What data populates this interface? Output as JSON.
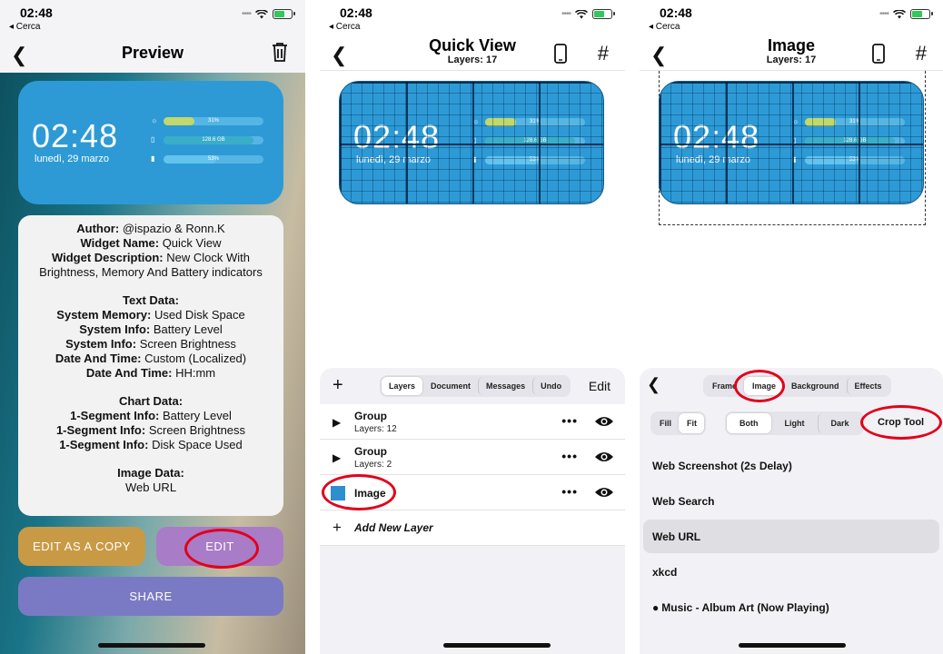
{
  "status": {
    "time": "02:48",
    "back": "◂ Cerca"
  },
  "widget": {
    "time": "02:48",
    "date": "lunedì, 29 marzo",
    "brightness": "31%",
    "memory": "128.6 GB",
    "battery": "53%",
    "brightness_fraction": 0.31,
    "memory_fraction": 0.9,
    "battery_fraction": 0.53,
    "colors": {
      "background": "#2d9ad6",
      "brightness_fill": "#c2d86a",
      "memory_fill": "#3aaec9",
      "battery_fill": "#62c4ee"
    }
  },
  "preview": {
    "title": "Preview",
    "info": {
      "author_label": "Author:",
      "author": "@ispazio & Ronn.K",
      "name_label": "Widget Name:",
      "name": "Quick View",
      "desc_label": "Widget Description:",
      "desc1": "New Clock With",
      "desc2": "Brightness, Memory And Battery indicators",
      "text_heading": "Text Data:",
      "text_rows": [
        {
          "k": "System Memory:",
          "v": "Used Disk Space"
        },
        {
          "k": "System Info:",
          "v": "Battery Level"
        },
        {
          "k": "System Info:",
          "v": "Screen Brightness"
        },
        {
          "k": "Date And Time:",
          "v": "Custom (Localized)"
        },
        {
          "k": "Date And Time:",
          "v": "HH:mm"
        }
      ],
      "chart_heading": "Chart Data:",
      "chart_rows": [
        {
          "k": "1-Segment Info:",
          "v": "Battery Level"
        },
        {
          "k": "1-Segment Info:",
          "v": "Screen Brightness"
        },
        {
          "k": "1-Segment Info:",
          "v": "Disk Space Used"
        }
      ],
      "image_heading": "Image Data:",
      "image_value": "Web URL"
    },
    "buttons": {
      "copy": "EDIT AS A COPY",
      "edit": "EDIT",
      "share": "SHARE"
    }
  },
  "quickview": {
    "title": "Quick View",
    "subtitle": "Layers: 17",
    "tabs": [
      "Layers",
      "Document",
      "Messages",
      "Undo"
    ],
    "edit": "Edit",
    "layers": [
      {
        "name": "Group",
        "count": "Layers: 12"
      },
      {
        "name": "Group",
        "count": "Layers: 2"
      },
      {
        "name": "Image",
        "count": ""
      }
    ],
    "add_layer": "Add New Layer"
  },
  "imageview": {
    "title": "Image",
    "subtitle": "Layers: 17",
    "tabs": [
      "Frame",
      "Image",
      "Background",
      "Effects"
    ],
    "modes": [
      "Fill",
      "Fit",
      "Both",
      "Light",
      "Dark"
    ],
    "crop": "Crop Tool",
    "options": [
      "Web Screenshot (2s Delay)",
      "Web Search",
      "Web URL",
      "xkcd",
      "Music - Album Art (Now Playing)"
    ],
    "selected_option": "Web URL"
  }
}
